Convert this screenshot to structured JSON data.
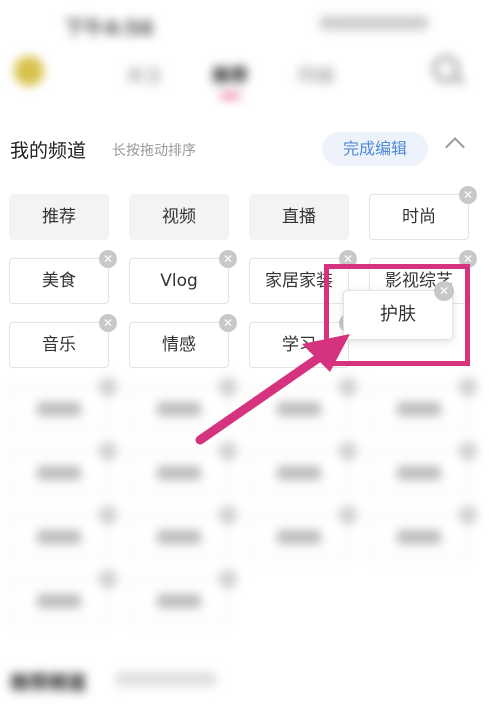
{
  "status_bar": {
    "time": "下午4:56"
  },
  "top_nav": {
    "tabs": [
      {
        "label": "关注"
      },
      {
        "label": "推荐"
      },
      {
        "label": "同城"
      }
    ]
  },
  "my_channels": {
    "title": "我的频道",
    "hint": "长按拖动排序",
    "done_label": "完成编辑"
  },
  "channels": [
    {
      "label": "推荐",
      "removable": false
    },
    {
      "label": "视频",
      "removable": false
    },
    {
      "label": "直播",
      "removable": false
    },
    {
      "label": "时尚",
      "removable": true
    },
    {
      "label": "美食",
      "removable": true
    },
    {
      "label": "Vlog",
      "removable": true
    },
    {
      "label": "家居家装",
      "removable": true
    },
    {
      "label": "影视综艺",
      "removable": true
    },
    {
      "label": "音乐",
      "removable": true
    },
    {
      "label": "情感",
      "removable": true
    },
    {
      "label": "学习",
      "removable": true
    }
  ],
  "dragging_channel": {
    "label": "护肤"
  },
  "recommended": {
    "title": "推荐频道"
  },
  "colors": {
    "accent": "#d6337f",
    "link": "#4d8bd9",
    "tab_underline": "#e8386a"
  }
}
